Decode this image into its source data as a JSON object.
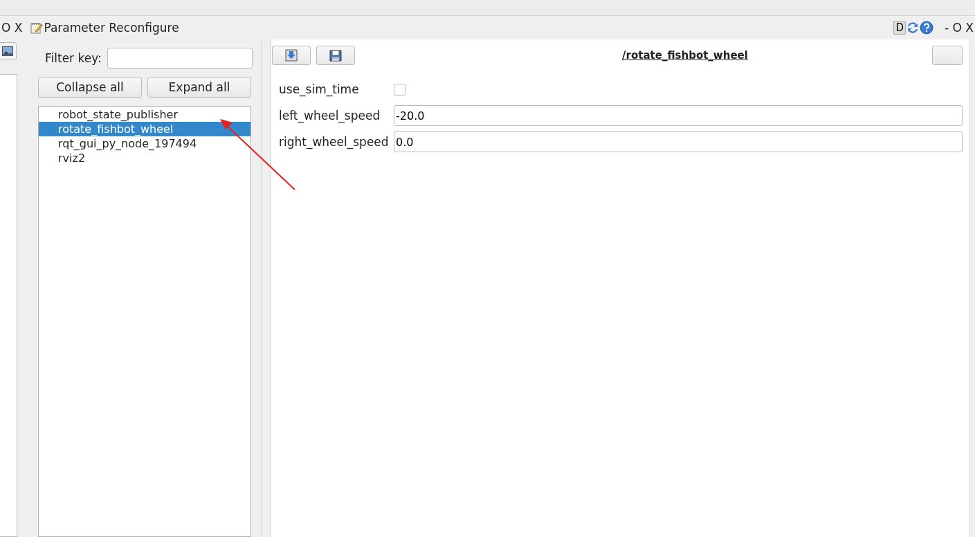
{
  "left_dock_controls": "O X",
  "window": {
    "title": "Parameter Reconfigure",
    "controls": "- O X",
    "d_button": "D"
  },
  "filter": {
    "label": "Filter key:"
  },
  "buttons": [
    "Collapse all",
    "Expand all"
  ],
  "nodes": [
    {
      "label": "robot_state_publisher",
      "selected": false
    },
    {
      "label": "rotate_fishbot_wheel",
      "selected": true
    },
    {
      "label": "rqt_gui_py_node_197494",
      "selected": false
    },
    {
      "label": "rviz2",
      "selected": false
    }
  ],
  "editor": {
    "title": "/rotate_fishbot_wheel",
    "params": [
      {
        "kind": "checkbox",
        "name": "use_sim_time",
        "checked": false
      },
      {
        "kind": "text",
        "name": "left_wheel_speed",
        "value": "-20.0"
      },
      {
        "kind": "text",
        "name": "right_wheel_speed",
        "value": "0.0"
      }
    ]
  }
}
